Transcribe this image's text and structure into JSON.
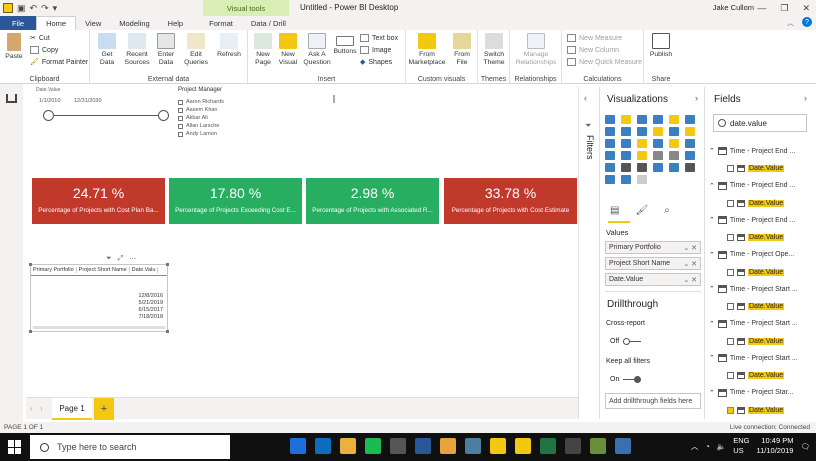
{
  "window": {
    "title": "Untitled - Power BI Desktop",
    "user": "Jake Cullom",
    "contextual_tab_group": "Visual tools"
  },
  "tabs": [
    "File",
    "Home",
    "View",
    "Modeling",
    "Help",
    "Format",
    "Data / Drill"
  ],
  "ribbon": {
    "clipboard": {
      "label": "Clipboard",
      "paste": "Paste",
      "cut": "Cut",
      "copy": "Copy",
      "format_painter": "Format Painter"
    },
    "external_data": {
      "label": "External data",
      "get_data": "Get Data",
      "recent_sources": "Recent Sources",
      "enter_data": "Enter Data",
      "edit_queries": "Edit Queries",
      "refresh": "Refresh"
    },
    "insert": {
      "label": "Insert",
      "new_page": "New Page",
      "new_visual": "New Visual",
      "ask_question": "Ask A Question",
      "buttons": "Buttons",
      "text_box": "Text box",
      "image": "Image",
      "shapes": "Shapes"
    },
    "custom_visuals": {
      "label": "Custom visuals",
      "from_marketplace": "From Marketplace",
      "from_file": "From File"
    },
    "themes": {
      "label": "Themes",
      "switch_theme": "Switch Theme"
    },
    "relationships": {
      "label": "Relationships",
      "manage": "Manage Relationships"
    },
    "calculations": {
      "label": "Calculations",
      "new_measure": "New Measure",
      "new_column": "New Column",
      "new_quick_measure": "New Quick Measure"
    },
    "share": {
      "label": "Share",
      "publish": "Publish"
    }
  },
  "canvas": {
    "date_slicer": {
      "header": "Date.Value",
      "start": "1/1/2010",
      "end": "12/31/2030",
      "start_fraction": 0.0,
      "end_fraction": 1.0
    },
    "pm_slicer": {
      "header": "Project Manager",
      "items": [
        "Aaron Richards",
        "Aasem Khan",
        "Akbar Ali",
        "Allan Larsche",
        "Andy Lamon"
      ]
    },
    "kpis": [
      {
        "value": "24.71 %",
        "label": "Percentage of Projects with Cost Plan Ba...",
        "color": "#c0392b"
      },
      {
        "value": "17.80 %",
        "label": "Percentage of Projects Exceeding Cost E...",
        "color": "#27ae60"
      },
      {
        "value": "2.98 %",
        "label": "Percentage of Projects with Associated R...",
        "color": "#27ae60"
      },
      {
        "value": "33.78 %",
        "label": "Percentage of Projects with Cost Estimate",
        "color": "#c0392b"
      }
    ],
    "table": {
      "columns": [
        "Primary Portfolio",
        "Project Short Name",
        "Date.Valu"
      ],
      "dates": [
        "12/8/2016",
        "5/21/2019",
        "6/15/2017",
        "7/18/2018"
      ]
    }
  },
  "pages": {
    "tabs": [
      "Page 1"
    ],
    "add": "+"
  },
  "filters_label": "Filters",
  "visualizations": {
    "title": "Visualizations",
    "values_label": "Values",
    "wells": [
      "Primary Portfolio",
      "Project Short Name",
      "Date.Value"
    ],
    "drillthrough": "Drillthrough",
    "cross_report": "Cross-report",
    "cross_report_state": "Off",
    "keep_all_filters": "Keep all filters",
    "keep_state": "On",
    "add_drill_fields": "Add drillthrough fields here"
  },
  "fields": {
    "title": "Fields",
    "search_value": "date.value",
    "tables": [
      {
        "name": "Time - Project End ...",
        "field": "Date.Value",
        "checked": false
      },
      {
        "name": "Time - Project End ...",
        "field": "Date.Value",
        "checked": false
      },
      {
        "name": "Time - Project End ...",
        "field": "Date.Value",
        "checked": false
      },
      {
        "name": "Time - Project Ope...",
        "field": "Date.Value",
        "checked": false
      },
      {
        "name": "Time - Project Start ...",
        "field": "Date.Value",
        "checked": false
      },
      {
        "name": "Time - Project Start ...",
        "field": "Date.Value",
        "checked": false
      },
      {
        "name": "Time - Project Start ...",
        "field": "Date.Value",
        "checked": false
      },
      {
        "name": "Time - Project Star...",
        "field": "Date.Value",
        "checked": true
      }
    ]
  },
  "status": {
    "page": "PAGE 1 OF 1",
    "connection": "Live connection: Connected"
  },
  "taskbar": {
    "search_placeholder": "Type here to search",
    "lang": "ENG",
    "region": "US",
    "time": "10:49 PM",
    "date": "11/10/2019"
  }
}
